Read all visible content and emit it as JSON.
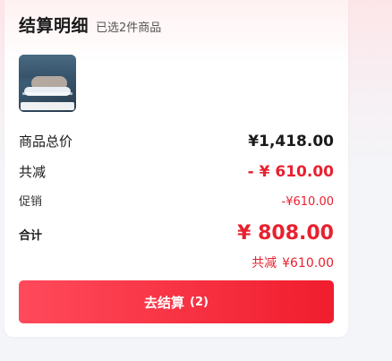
{
  "header": {
    "title": "结算明细",
    "subtitle": "已选2件商品"
  },
  "summary": {
    "total_label": "商品总价",
    "total_value": "¥1,418.00",
    "discount_label": "共减",
    "discount_value": "- ¥ 610.00",
    "promo_label": "促销",
    "promo_value": "-¥610.00",
    "sum_label": "合计",
    "sum_value": "¥ 808.00",
    "saved_label": "共减",
    "saved_value": "¥610.00"
  },
  "checkout": {
    "label": "去结算",
    "count": "(2)"
  },
  "colors": {
    "accent": "#e8212f",
    "button_start": "#ff4a5b",
    "button_end": "#f01d2d"
  }
}
